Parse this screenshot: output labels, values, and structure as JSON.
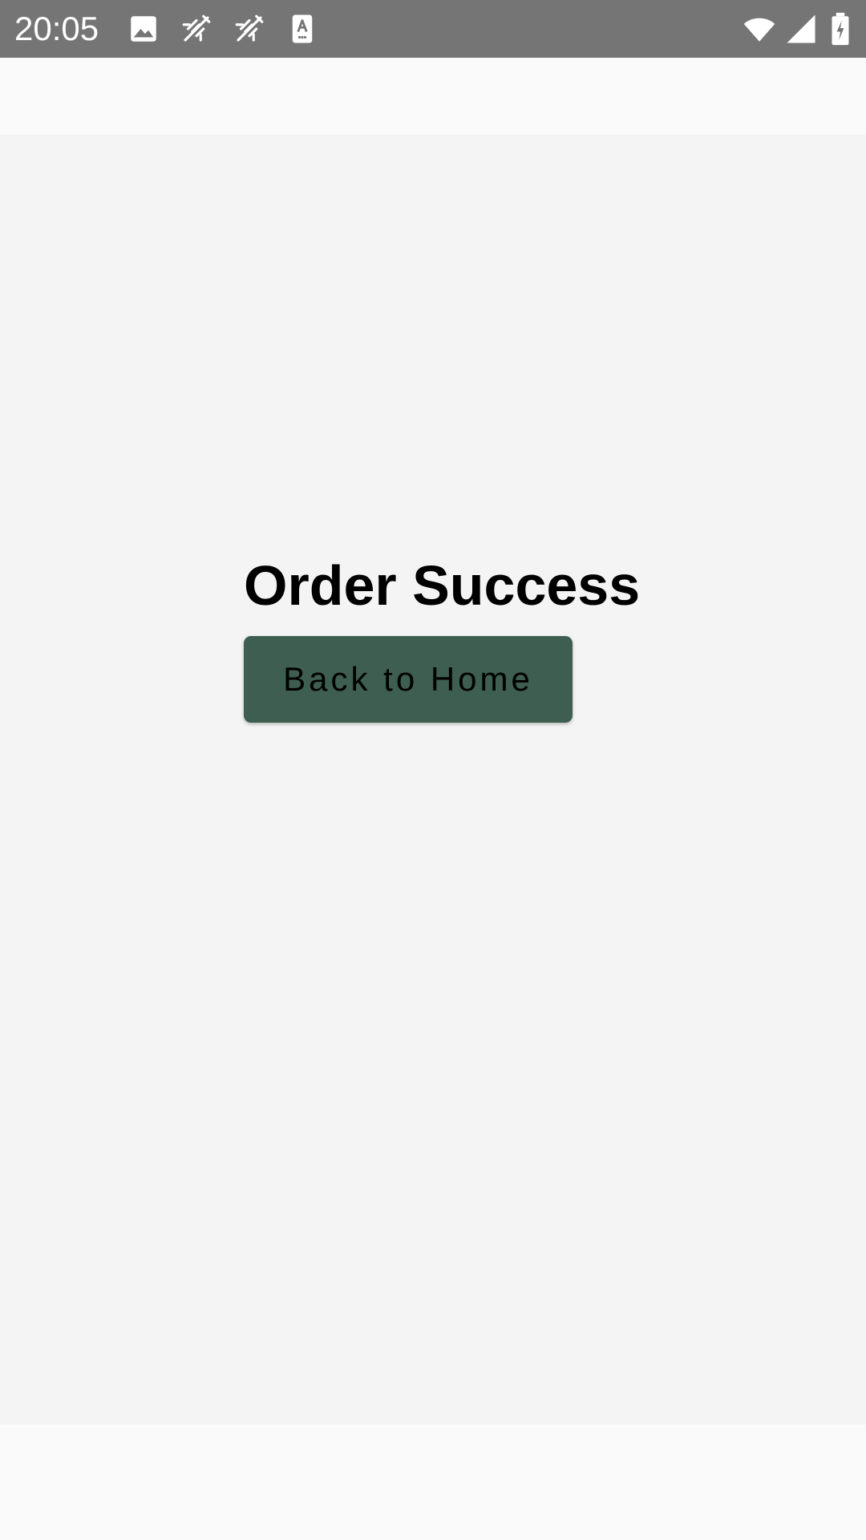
{
  "status_bar": {
    "time": "20:05",
    "background_color": "#757575",
    "left_icons": [
      "image-icon",
      "sync-off-icon",
      "sync-off-icon",
      "keyboard-a-icon"
    ],
    "right_icons": [
      "wifi-icon",
      "cell-signal-icon",
      "battery-charging-icon"
    ]
  },
  "main": {
    "title": "Order Success",
    "back_button_label": "Back to Home",
    "button_color": "#3d5e51",
    "background_color": "#f4f4f4"
  }
}
